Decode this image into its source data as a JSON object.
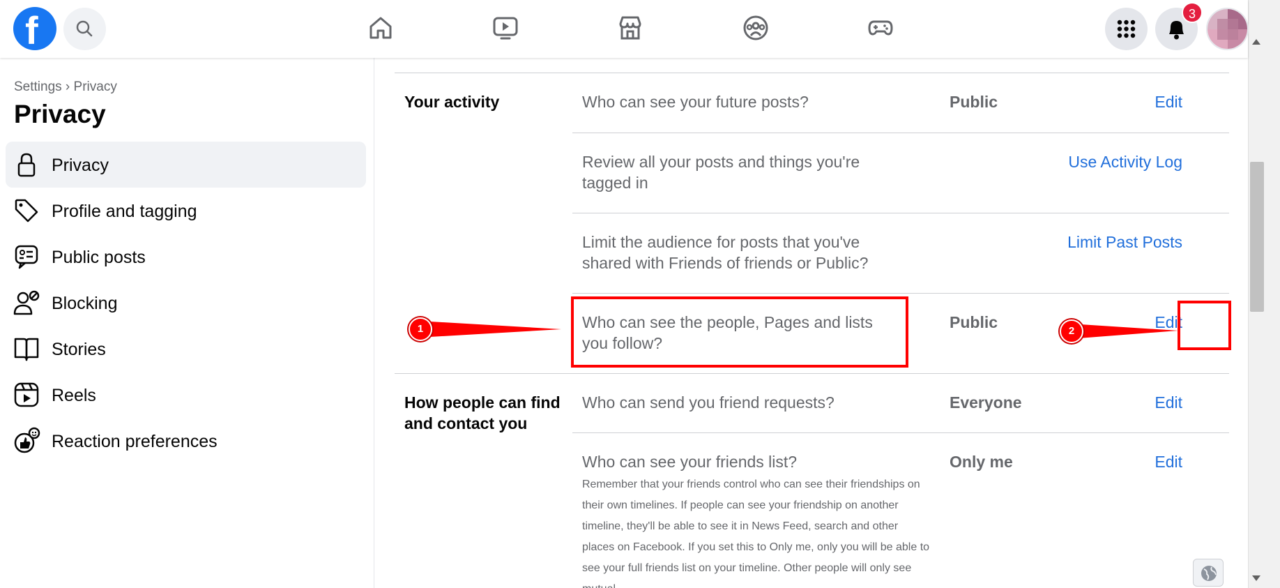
{
  "topbar": {
    "logo_letter": "f",
    "notification_count": "3"
  },
  "sidebar": {
    "breadcrumb": "Settings › Privacy",
    "title": "Privacy",
    "items": [
      {
        "label": "Privacy",
        "icon": "lock-icon",
        "active": true
      },
      {
        "label": "Profile and tagging",
        "icon": "tag-icon"
      },
      {
        "label": "Public posts",
        "icon": "public-posts-icon"
      },
      {
        "label": "Blocking",
        "icon": "blocking-icon"
      },
      {
        "label": "Stories",
        "icon": "book-icon"
      },
      {
        "label": "Reels",
        "icon": "reels-icon"
      },
      {
        "label": "Reaction preferences",
        "icon": "reaction-icon"
      }
    ]
  },
  "main": {
    "sections": [
      {
        "title": "Your activity",
        "rows": [
          {
            "question": "Who can see your future posts?",
            "value": "Public",
            "action": "Edit"
          },
          {
            "question": "Review all your posts and things you're tagged in",
            "value": "",
            "action": "Use Activity Log"
          },
          {
            "question": "Limit the audience for posts that you've shared with Friends of friends or Public?",
            "value": "",
            "action": "Limit Past Posts"
          },
          {
            "question": "Who can see the people, Pages and lists you follow?",
            "value": "Public",
            "action": "Edit"
          }
        ]
      },
      {
        "title": "How people can find and contact you",
        "rows": [
          {
            "question": "Who can send you friend requests?",
            "value": "Everyone",
            "action": "Edit"
          },
          {
            "question": "Who can see your friends list?",
            "value": "Only me",
            "action": "Edit",
            "description": "Remember that your friends control who can see their friendships on their own timelines. If people can see your friendship on another timeline, they'll be able to see it in News Feed, search and other places on Facebook. If you set this to Only me, only you will be able to see your full friends list on your timeline. Other people will only see mutual"
          }
        ]
      }
    ]
  },
  "annotations": {
    "marker_1": "1",
    "marker_2": "2"
  },
  "colors": {
    "accent": "#1877f2",
    "link": "#216fdb",
    "annotation": "#ff0000",
    "badge": "#e41e3f"
  }
}
